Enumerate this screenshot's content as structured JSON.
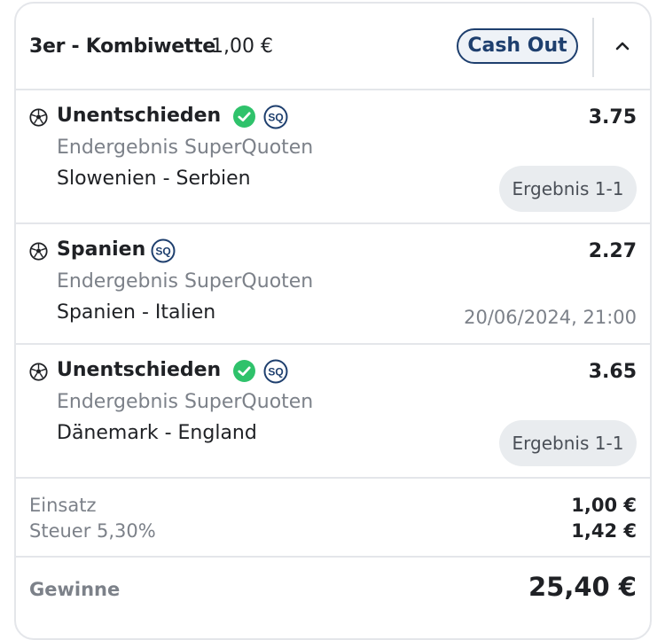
{
  "header": {
    "title": "3er - Kombiwette",
    "stake": "1,00 €",
    "cashout_label": "Cash Out"
  },
  "legs": [
    {
      "selection": "Unentschieden",
      "won": true,
      "sq_badge": "SQ",
      "odds": "3.75",
      "market": "Endergebnis SuperQuoten",
      "match": "Slowenien - Serbien",
      "result_label": "Ergebnis 1-1"
    },
    {
      "selection": "Spanien",
      "won": false,
      "sq_badge": "SQ",
      "odds": "2.27",
      "market": "Endergebnis SuperQuoten",
      "match": "Spanien - Italien",
      "kickoff": "20/06/2024, 21:00"
    },
    {
      "selection": "Unentschieden",
      "won": true,
      "sq_badge": "SQ",
      "odds": "3.65",
      "market": "Endergebnis SuperQuoten",
      "match": "Dänemark - England",
      "result_label": "Ergebnis 1-1"
    }
  ],
  "totals": {
    "stake_label": "Einsatz",
    "stake_value": "1,00 €",
    "tax_label": "Steuer 5,30%",
    "tax_value": "1,42 €"
  },
  "winnings": {
    "label": "Gewinne",
    "value": "25,40 €"
  },
  "colors": {
    "brand_navy": "#1e3f6e",
    "success_green": "#2fc26b",
    "muted_text": "#7c8189"
  },
  "icons": {
    "sport": "football-icon",
    "won": "check-circle-icon",
    "superquote": "sq-badge-icon",
    "collapse": "chevron-up-icon"
  }
}
